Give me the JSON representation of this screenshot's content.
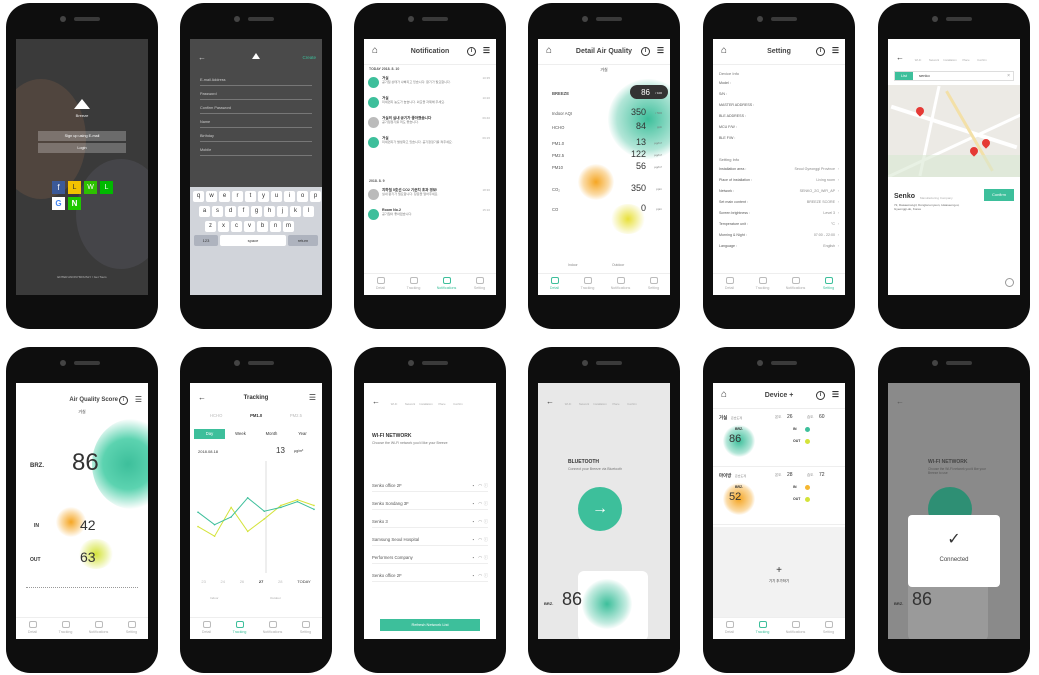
{
  "colors": {
    "accent": "#3dbf9b",
    "warm": "#f5b731",
    "bg_grey": "#e8e8e8"
  },
  "login": {
    "logo_text": "Breeze",
    "signup_label": "Sign up using E-mail",
    "login_label": "Login",
    "social": [
      "f",
      "L",
      "W",
      "L",
      "G",
      "N"
    ],
    "footer": "ENTER ANONYMOUSLY / Get Tours"
  },
  "signup": {
    "create_label": "Create",
    "fields": [
      "E-mail Address",
      "Password",
      "Confirm Password",
      "Name",
      "Birthday",
      "Mobile"
    ],
    "keys_row1": [
      "q",
      "w",
      "e",
      "r",
      "t",
      "y",
      "u",
      "i",
      "o",
      "p"
    ],
    "keys_row2": [
      "a",
      "s",
      "d",
      "f",
      "g",
      "h",
      "j",
      "k",
      "l"
    ],
    "keys_row3": [
      "z",
      "x",
      "c",
      "v",
      "b",
      "n",
      "m"
    ],
    "key_123": "123",
    "key_space": "space",
    "key_return": "return"
  },
  "notification": {
    "title": "Notification",
    "today_label": "TODAY  2018. 8. 10",
    "date2": "2018. 8. 9",
    "items": [
      {
        "tag": "실내",
        "title": "거실",
        "text": "공기질 상태가 나빠지고 있습니다. 환기가 필요합니다.",
        "time": "10:35"
      },
      {
        "tag": "실외",
        "title": "거실",
        "text": "미세먼지 농도가 높습니다. 외출을 자제해 주세요.",
        "time": "10:20"
      },
      {
        "tag": "",
        "title": "거실의 실내 공기가 좋아졌습니다",
        "text": "공기청정기를 꺼도 좋습니다.",
        "time": "09:40"
      },
      {
        "tag": "실내",
        "title": "거실",
        "text": "미세먼지가 발생하고 있습니다. 공기청정기를 켜주세요.",
        "time": "09:15"
      },
      {
        "tag": "",
        "title": "지하철 5호선 CO2 기준치 초과 경보!",
        "text": "실내 환기가 필요합니다. 창문을 열어주세요.",
        "time": "18:30"
      },
      {
        "tag": "실내",
        "title": "Room No.2",
        "text": "공기질이 좋아졌습니다.",
        "time": "15:10"
      }
    ]
  },
  "detail": {
    "title": "Detail Air Quality",
    "room": "거실",
    "rows": [
      {
        "label": "BREEZE",
        "value": "86",
        "unit": "/ 100"
      },
      {
        "label": "Indoor AQI",
        "value": "350",
        "unit": "/ 500"
      },
      {
        "label": "HCHO",
        "value": "84",
        "unit": "ppb"
      },
      {
        "label": "PM1.0",
        "value": "13",
        "unit": "µg/m³"
      },
      {
        "label": "PM2.5",
        "value": "122",
        "unit": "µg/m³"
      },
      {
        "label": "PM10",
        "value": "56",
        "unit": "µg/m³"
      },
      {
        "label": "CO₂",
        "value": "350",
        "unit": "ppm"
      },
      {
        "label": "CO",
        "value": "0",
        "unit": "ppm"
      }
    ],
    "legend": [
      "Indoor",
      "Outdoor"
    ]
  },
  "setting": {
    "title": "Setting",
    "device_info": "Device Info",
    "device_rows": [
      "Model :",
      "S/N :",
      "MASTER ADDRESS :",
      "BLE ADDRESS :",
      "MCU F/W :",
      "BLE F/W :"
    ],
    "setting_info": "Setting Info",
    "setting_rows": [
      {
        "k": "Installation area :",
        "v": "Seoul Gyeonggi Province"
      },
      {
        "k": "Place of installation :",
        "v": "Living room"
      },
      {
        "k": "Network :",
        "v": "SENKO_2G_WiFi_AP"
      },
      {
        "k": "Set main content :",
        "v": "BREEZE SCORE"
      },
      {
        "k": "Screen brightness :",
        "v": "Level 3"
      },
      {
        "k": "Temperature unit :",
        "v": "°C"
      },
      {
        "k": "Morning & Night :",
        "v": "07:00 - 22:00"
      },
      {
        "k": "Language :",
        "v": "English"
      }
    ]
  },
  "map": {
    "steps": [
      "Wi-Fi",
      "Network",
      "Installation",
      "Place",
      "Confirm"
    ],
    "list_label": "List",
    "search_value": "senko",
    "company": "Senko",
    "company_sub": "Manufacturing Company",
    "address": "72, Dasaemal-gil, Dongtan-myeon, Hwaseong-si, Gyeonggi-do, Korea",
    "confirm_label": "Confirm"
  },
  "score": {
    "title": "Air Quality Score",
    "room": "거실",
    "brz_label": "BRZ.",
    "brz_value": "86",
    "in_label": "IN",
    "in_value": "42",
    "out_label": "OUT",
    "out_value": "63"
  },
  "tracking": {
    "title": "Tracking",
    "tabs_top": [
      "HCHO",
      "PM1.0",
      "PM2.5"
    ],
    "ranges": [
      "Day",
      "Week",
      "Month",
      "Year"
    ],
    "date": "2018.08.18",
    "value": "13",
    "unit": "µg/m³",
    "dates": [
      "23",
      "24",
      "26",
      "27",
      "28",
      "TODAY"
    ],
    "legend": [
      "Indoor",
      "Outdoor"
    ]
  },
  "chart_data": {
    "type": "line",
    "series": [
      {
        "values": [
          40,
          30,
          60,
          35,
          48,
          62,
          68,
          62
        ]
      },
      {
        "values": [
          55,
          42,
          50,
          70,
          56,
          60,
          66,
          58
        ]
      }
    ]
  },
  "wifi": {
    "title": "WI-FI NETWORK",
    "subtitle": "Choose the Wi-Fi network you'd like your Breeze",
    "networks": [
      "Senko office 2F",
      "Senko Sondang 3F",
      "Senko 3",
      "Samsung Seoul Hospital",
      "Performers Company",
      "Senko office 2F"
    ],
    "refresh_label": "Refresh Network List"
  },
  "bluetooth": {
    "title": "BLUETOOTH",
    "subtitle": "Connect your Breeze via Bluetooth",
    "brz_label": "BRZ.",
    "brz_value": "86"
  },
  "devices": {
    "title": "Device +",
    "room1": "거실",
    "room1_sub": "온습도계",
    "temp1": "26",
    "hum1": "60",
    "brz1": "86",
    "room2": "마이방",
    "room2_sub": "온습도계",
    "temp2": "28",
    "hum2": "72",
    "brz2": "52",
    "in_label": "IN",
    "out_label": "OUT",
    "add_label": "기기 추가하기",
    "t_label": "온도",
    "h_label": "습도",
    "brz_label": "BRZ."
  },
  "connected": {
    "title": "WI-FI NETWORK",
    "subtitle": "Choose the Wi-Fi network you'd like your Breeze to use",
    "check": "✓",
    "label": "Connected",
    "brz_label": "BRZ.",
    "brz_value": "86"
  },
  "tabs": [
    "Detail",
    "Tracking",
    "Notifications",
    "Setting"
  ]
}
